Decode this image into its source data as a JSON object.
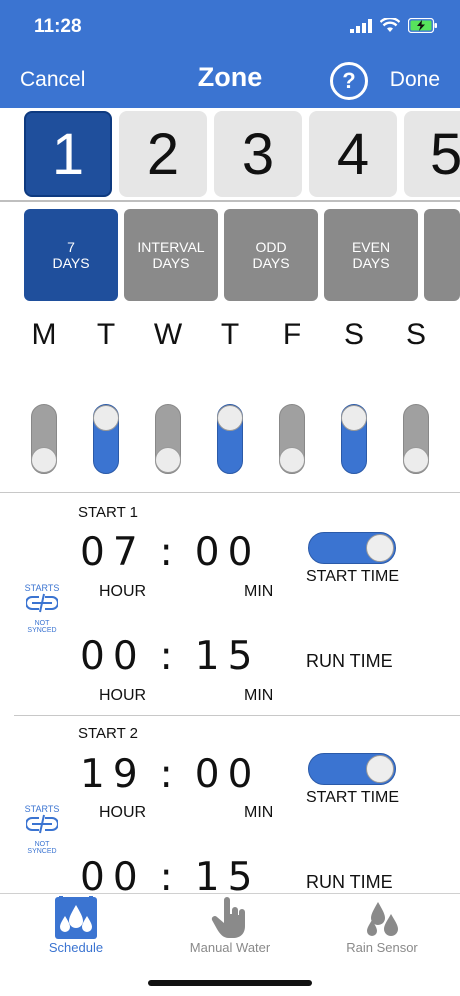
{
  "status": {
    "time": "11:28"
  },
  "header": {
    "cancel": "Cancel",
    "title": "Zone",
    "help": "?",
    "done": "Done"
  },
  "zones": [
    "1",
    "2",
    "3",
    "4",
    "5"
  ],
  "schedule_types": [
    "7\nDAYS",
    "INTERVAL\nDAYS",
    "ODD\nDAYS",
    "EVEN\nDAYS"
  ],
  "days": [
    {
      "label": "M",
      "on": false
    },
    {
      "label": "T",
      "on": true
    },
    {
      "label": "W",
      "on": false
    },
    {
      "label": "T",
      "on": true
    },
    {
      "label": "F",
      "on": false
    },
    {
      "label": "S",
      "on": true
    },
    {
      "label": "S",
      "on": false
    }
  ],
  "starts": [
    {
      "label": "START 1",
      "start_hour": "07",
      "start_min": "00",
      "run_hour": "00",
      "run_min": "15",
      "start_time_label": "START TIME",
      "run_time_label": "RUN TIME",
      "hour_label": "HOUR",
      "min_label": "MIN",
      "sync_title": "STARTS",
      "sync_status": "NOT SYNCED",
      "enabled": true
    },
    {
      "label": "START 2",
      "start_hour": "19",
      "start_min": "00",
      "run_hour": "00",
      "run_min": "15",
      "start_time_label": "START TIME",
      "run_time_label": "RUN TIME",
      "hour_label": "HOUR",
      "min_label": "MIN",
      "sync_title": "STARTS",
      "sync_status": "NOT SYNCED",
      "enabled": true
    }
  ],
  "tabs": [
    {
      "label": "Schedule",
      "icon": "schedule-drops-icon",
      "active": true
    },
    {
      "label": "Manual Water",
      "icon": "hand-tap-icon",
      "active": false
    },
    {
      "label": "Rain Sensor",
      "icon": "rain-drops-icon",
      "active": false
    }
  ],
  "colors": {
    "accent": "#3b74d1",
    "active_tile": "#1f4f9c",
    "inactive_button": "#8a8a8a"
  }
}
